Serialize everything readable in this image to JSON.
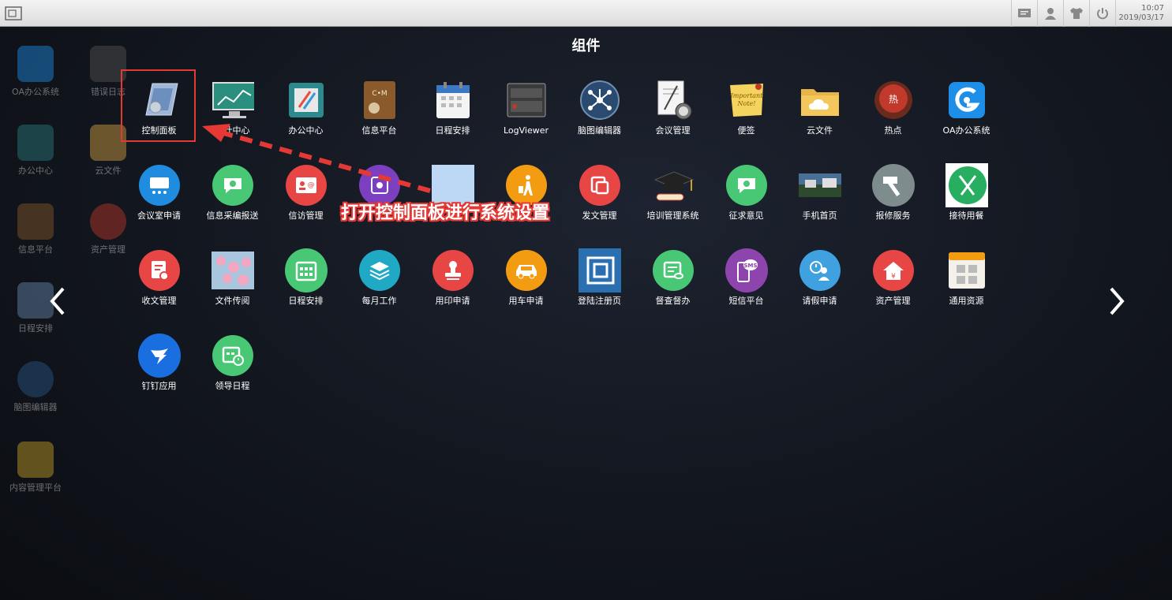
{
  "topbar": {
    "clock_time": "10:07",
    "clock_date": "2019/03/17"
  },
  "panel": {
    "title": "组件"
  },
  "desktop_icons": [
    {
      "label": "OA办公系统"
    },
    {
      "label": "错误日志"
    },
    {
      "label": "办公中心"
    },
    {
      "label": "云文件"
    },
    {
      "label": "信息平台"
    },
    {
      "label": "资产管理"
    },
    {
      "label": "日程安排"
    },
    {
      "label": "脑图编辑器"
    },
    {
      "label": "内容管理平台"
    }
  ],
  "apps": [
    {
      "label": "控制面板",
      "icon": "control-panel-icon"
    },
    {
      "label": "统计中心",
      "icon": "statistics-icon"
    },
    {
      "label": "办公中心",
      "icon": "office-center-icon"
    },
    {
      "label": "信息平台",
      "icon": "info-platform-icon"
    },
    {
      "label": "日程安排",
      "icon": "calendar-icon"
    },
    {
      "label": "LogViewer",
      "icon": "log-viewer-icon"
    },
    {
      "label": "脑图编辑器",
      "icon": "mindmap-icon"
    },
    {
      "label": "会议管理",
      "icon": "meeting-icon"
    },
    {
      "label": "便签",
      "icon": "sticky-note-icon"
    },
    {
      "label": "云文件",
      "icon": "cloud-folder-icon"
    },
    {
      "label": "热点",
      "icon": "hotspot-icon"
    },
    {
      "label": "OA办公系统",
      "icon": "oa-system-icon"
    },
    {
      "label": "会议室申请",
      "icon": "meeting-room-icon"
    },
    {
      "label": "信息采编报送",
      "icon": "chat-icon"
    },
    {
      "label": "信访管理",
      "icon": "petition-icon"
    },
    {
      "label": "",
      "icon": "purple-app-icon"
    },
    {
      "label": "",
      "icon": "blank-app-icon"
    },
    {
      "label": "",
      "icon": "travel-icon"
    },
    {
      "label": "发文管理",
      "icon": "send-doc-icon"
    },
    {
      "label": "培训管理系统",
      "icon": "graduation-cap-icon"
    },
    {
      "label": "征求意见",
      "icon": "opinion-icon"
    },
    {
      "label": "手机首页",
      "icon": "mobile-home-icon"
    },
    {
      "label": "报修服务",
      "icon": "hammer-icon"
    },
    {
      "label": "接待用餐",
      "icon": "dining-icon"
    },
    {
      "label": "收文管理",
      "icon": "receive-doc-icon"
    },
    {
      "label": "文件传阅",
      "icon": "flower-photo-icon"
    },
    {
      "label": "日程安排",
      "icon": "calendar-grid-icon"
    },
    {
      "label": "每月工作",
      "icon": "layers-icon"
    },
    {
      "label": "用印申请",
      "icon": "stamp-icon"
    },
    {
      "label": "用车申请",
      "icon": "car-icon"
    },
    {
      "label": "登陆注册页",
      "icon": "login-page-icon"
    },
    {
      "label": "督查督办",
      "icon": "supervise-icon"
    },
    {
      "label": "短信平台",
      "icon": "sms-icon"
    },
    {
      "label": "请假申请",
      "icon": "leave-icon"
    },
    {
      "label": "资产管理",
      "icon": "asset-icon"
    },
    {
      "label": "通用资源",
      "icon": "resources-icon"
    },
    {
      "label": "钉钉应用",
      "icon": "dingtalk-icon"
    },
    {
      "label": "领导日程",
      "icon": "leader-schedule-icon"
    }
  ],
  "annotation": {
    "text": "打开控制面板进行系统设置"
  }
}
